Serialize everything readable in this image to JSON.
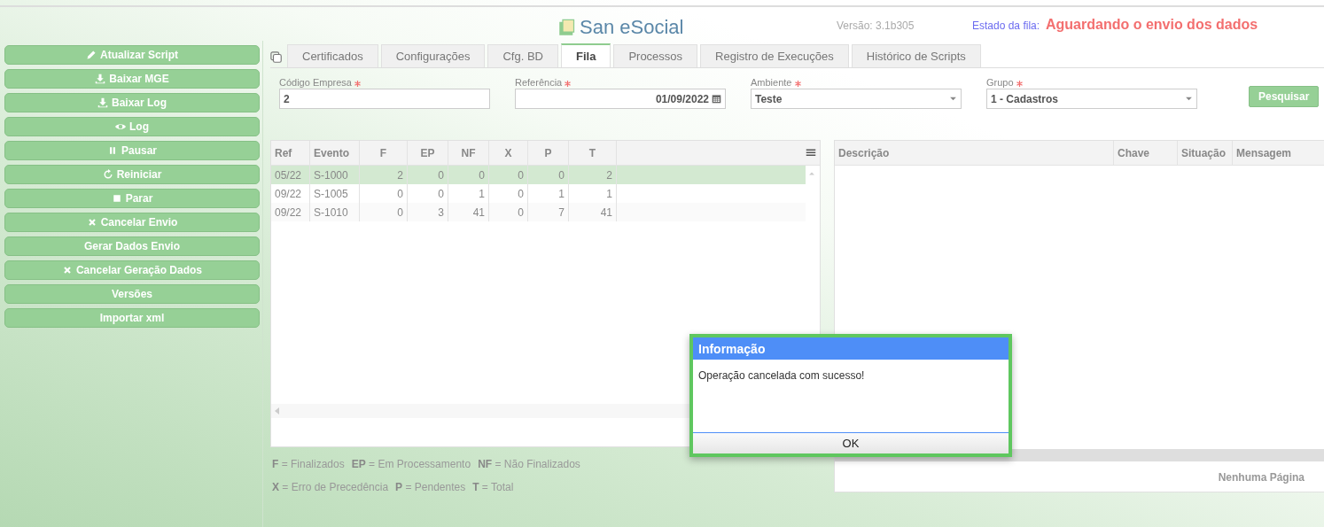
{
  "header": {
    "logo": "San eSocial",
    "version": "Versão: 3.1b305",
    "queue_label": "Estado da fila:",
    "queue_status": "Aguardando o envio dos dados"
  },
  "sidebar": {
    "buttons": [
      {
        "label": "Atualizar Script",
        "kind": "edit"
      },
      {
        "label": "Baixar MGE",
        "kind": "download"
      },
      {
        "label": "Baixar Log",
        "kind": "download"
      },
      {
        "label": "Log",
        "kind": "view"
      },
      {
        "label": "Pausar",
        "kind": "pause"
      },
      {
        "label": "Reiniciar",
        "kind": "restart"
      },
      {
        "label": "Parar",
        "kind": "stop"
      },
      {
        "label": "Cancelar Envio",
        "kind": "cancel"
      },
      {
        "label": "Gerar Dados Envio",
        "kind": "plain"
      },
      {
        "label": "Cancelar Geração Dados",
        "kind": "cancel"
      },
      {
        "label": "Versões",
        "kind": "plain"
      },
      {
        "label": "Importar xml",
        "kind": "plain"
      }
    ]
  },
  "tabs": [
    {
      "label": "Certificados",
      "selected": false
    },
    {
      "label": "Configurações",
      "selected": false
    },
    {
      "label": "Cfg. BD",
      "selected": false
    },
    {
      "label": "Fila",
      "selected": true
    },
    {
      "label": "Processos",
      "selected": false
    },
    {
      "label": "Registro de Execuções",
      "selected": false
    },
    {
      "label": "Histórico de Scripts",
      "selected": false
    }
  ],
  "filters": [
    {
      "label": "Código Empresa",
      "required": true,
      "kind": "text",
      "value": "2"
    },
    {
      "label": "Referência",
      "required": true,
      "kind": "date",
      "value": "01/09/2022"
    },
    {
      "label": "Ambiente",
      "required": true,
      "kind": "select",
      "value": "Teste"
    },
    {
      "label": "Grupo",
      "required": true,
      "kind": "select",
      "value": "1 - Cadastros"
    }
  ],
  "search_button": "Pesquisar",
  "queue_table": {
    "columns": [
      "Ref",
      "Evento",
      "F",
      "EP",
      "NF",
      "X",
      "P",
      "T"
    ],
    "rows": [
      {
        "cells": [
          "05/22",
          "S-1000",
          "2",
          "0",
          "0",
          "0",
          "0",
          "2"
        ],
        "selected": true
      },
      {
        "cells": [
          "09/22",
          "S-1005",
          "0",
          "0",
          "1",
          "0",
          "1",
          "1"
        ],
        "selected": false
      },
      {
        "cells": [
          "09/22",
          "S-1010",
          "0",
          "3",
          "41",
          "0",
          "7",
          "41"
        ],
        "selected": false
      }
    ]
  },
  "legend": [
    [
      "**F** = Finalizados",
      "**EP** = Em Processamento",
      "**NF** = Não Finalizados"
    ],
    [
      "**X** = Erro de Precedência",
      "**P** = Pendentes",
      "**T** = Total"
    ]
  ],
  "detail_table": {
    "columns": [
      "Descrição",
      "Chave",
      "Situação",
      "Mensagem"
    ],
    "pager": "Nenhuma Página"
  },
  "dialog": {
    "title": "Informação",
    "message": "Operação cancelada com sucesso!",
    "button": "OK"
  }
}
